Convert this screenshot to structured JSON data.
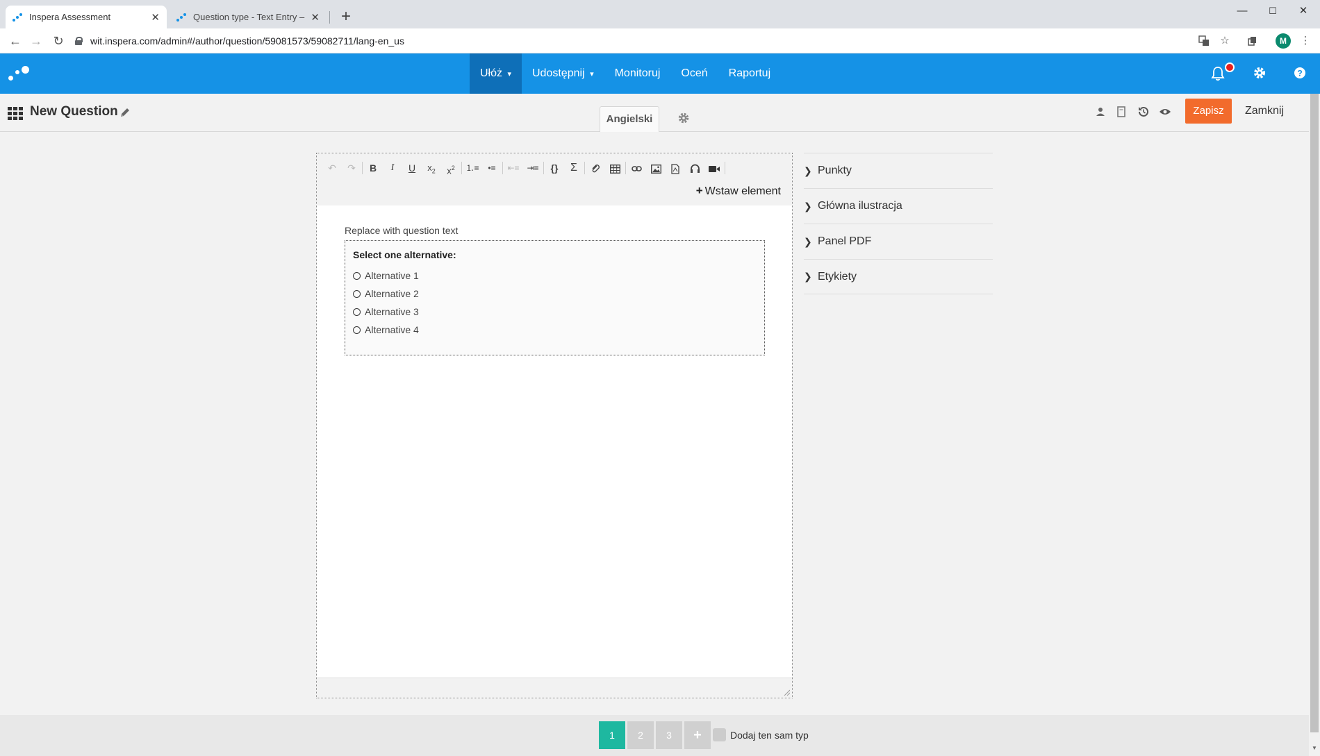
{
  "browser": {
    "tabs": [
      {
        "title": "Inspera Assessment",
        "active": true
      },
      {
        "title": "Question type - Text Entry – Insp",
        "active": false
      }
    ],
    "new_tab": "+",
    "window": {
      "minimize": "—",
      "maximize": "☐",
      "close": "✕"
    },
    "url": "wit.inspera.com/admin#/author/question/59081573/59082711/lang-en_us",
    "profile_initial": "M"
  },
  "header": {
    "nav": [
      {
        "label": "Ułóż",
        "has_dropdown": true,
        "active": true
      },
      {
        "label": "Udostępnij",
        "has_dropdown": true,
        "active": false
      },
      {
        "label": "Monitoruj",
        "has_dropdown": false,
        "active": false
      },
      {
        "label": "Oceń",
        "has_dropdown": false,
        "active": false
      },
      {
        "label": "Raportuj",
        "has_dropdown": false,
        "active": false
      }
    ],
    "accent_color": "#1592e6",
    "active_color": "#0e6fb8"
  },
  "subheader": {
    "title": "New Question",
    "language_tab": "Angielski",
    "save_label": "Zapisz",
    "close_label": "Zamknij",
    "save_color": "#f26b2c"
  },
  "editor": {
    "insert_label": "Wstaw element",
    "question_text": "Replace with question text",
    "choice": {
      "title": "Select one alternative:",
      "alternatives": [
        "Alternative 1",
        "Alternative 2",
        "Alternative 3",
        "Alternative 4"
      ]
    }
  },
  "sidepanel": {
    "sections": [
      "Punkty",
      "Główna ilustracja",
      "Panel PDF",
      "Etykiety"
    ]
  },
  "footer": {
    "pages": [
      "1",
      "2",
      "3"
    ],
    "add_page": "+",
    "same_type_label": "Dodaj ten sam typ",
    "active_page_color": "#1eb8a0"
  }
}
